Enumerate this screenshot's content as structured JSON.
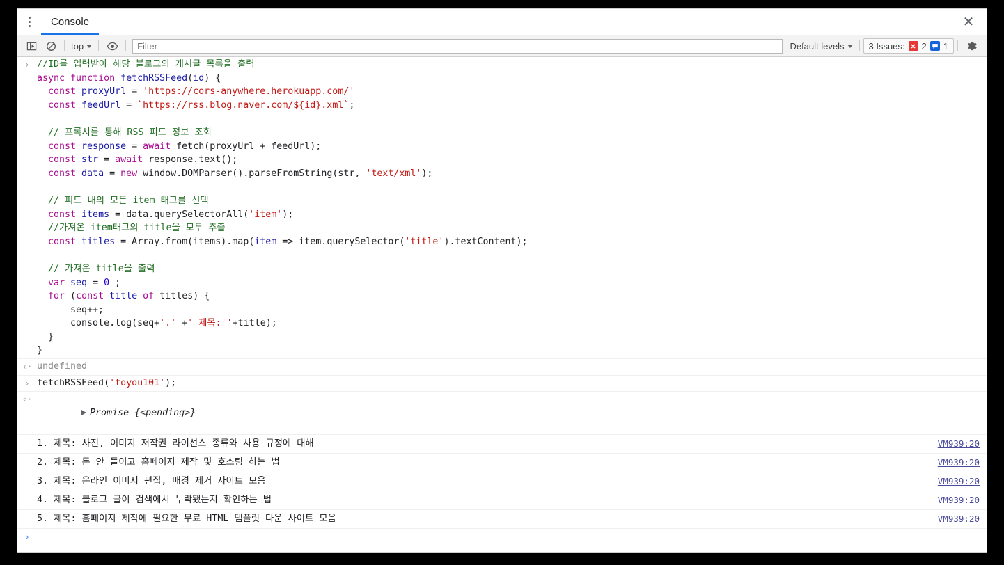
{
  "window": {
    "close_label": "✕"
  },
  "tabstrip": {
    "menu_icon": "more-vertical-icon",
    "tabs": [
      {
        "label": "Console",
        "active": true
      }
    ]
  },
  "toolbar": {
    "sidebar_toggle_icon": "show-console-sidebar-icon",
    "clear_console_icon": "clear-console-icon",
    "context_selector": {
      "label": "top"
    },
    "eye_icon": "live-expression-eye-icon",
    "filter": {
      "placeholder": "Filter",
      "value": ""
    },
    "levels_selector": {
      "label": "Default levels"
    },
    "issues": {
      "label": "3 Issues:",
      "error_count": "2",
      "message_count": "1",
      "error_color": "#e53935",
      "message_color": "#1565d8"
    },
    "settings_icon": "gear-icon"
  },
  "console": {
    "input_marker": "›",
    "output_marker": "‹·",
    "entries": [
      {
        "type": "input",
        "code_lines": [
          [
            {
              "t": "//ID를 입력받아 해당 블로그의 게시글 목록을 출력",
              "c": "cmt"
            }
          ],
          [
            {
              "t": "async ",
              "c": "kw"
            },
            {
              "t": "function ",
              "c": "kw"
            },
            {
              "t": "fetchRSSFeed",
              "c": "id"
            },
            {
              "t": "(",
              "c": "plain"
            },
            {
              "t": "id",
              "c": "id"
            },
            {
              "t": ") {",
              "c": "plain"
            }
          ],
          [
            {
              "t": "  const ",
              "c": "kw"
            },
            {
              "t": "proxyUrl",
              "c": "id"
            },
            {
              "t": " = ",
              "c": "plain"
            },
            {
              "t": "'https://cors-anywhere.herokuapp.com/'",
              "c": "str"
            }
          ],
          [
            {
              "t": "  const ",
              "c": "kw"
            },
            {
              "t": "feedUrl",
              "c": "id"
            },
            {
              "t": " = ",
              "c": "plain"
            },
            {
              "t": "`https://rss.blog.naver.com/${id}.xml`",
              "c": "str"
            },
            {
              "t": ";",
              "c": "plain"
            }
          ],
          [
            {
              "t": "",
              "c": "plain"
            }
          ],
          [
            {
              "t": "  // 프록시를 통해 RSS 피드 정보 조회",
              "c": "cmt"
            }
          ],
          [
            {
              "t": "  const ",
              "c": "kw"
            },
            {
              "t": "response",
              "c": "id"
            },
            {
              "t": " = ",
              "c": "plain"
            },
            {
              "t": "await ",
              "c": "kw"
            },
            {
              "t": "fetch(proxyUrl + feedUrl);",
              "c": "plain"
            }
          ],
          [
            {
              "t": "  const ",
              "c": "kw"
            },
            {
              "t": "str",
              "c": "id"
            },
            {
              "t": " = ",
              "c": "plain"
            },
            {
              "t": "await ",
              "c": "kw"
            },
            {
              "t": "response.text();",
              "c": "plain"
            }
          ],
          [
            {
              "t": "  const ",
              "c": "kw"
            },
            {
              "t": "data",
              "c": "id"
            },
            {
              "t": " = ",
              "c": "plain"
            },
            {
              "t": "new ",
              "c": "kw"
            },
            {
              "t": "window.DOMParser().parseFromString(str, ",
              "c": "plain"
            },
            {
              "t": "'text/xml'",
              "c": "str"
            },
            {
              "t": ");",
              "c": "plain"
            }
          ],
          [
            {
              "t": "",
              "c": "plain"
            }
          ],
          [
            {
              "t": "  // 피드 내의 모든 item 태그를 선택",
              "c": "cmt"
            }
          ],
          [
            {
              "t": "  const ",
              "c": "kw"
            },
            {
              "t": "items",
              "c": "id"
            },
            {
              "t": " = data.querySelectorAll(",
              "c": "plain"
            },
            {
              "t": "'item'",
              "c": "str"
            },
            {
              "t": ");",
              "c": "plain"
            }
          ],
          [
            {
              "t": "  //가져온 item태그의 title을 모두 추출",
              "c": "cmt"
            }
          ],
          [
            {
              "t": "  const ",
              "c": "kw"
            },
            {
              "t": "titles",
              "c": "id"
            },
            {
              "t": " = Array.from(items).map(",
              "c": "plain"
            },
            {
              "t": "item",
              "c": "id"
            },
            {
              "t": " => item.querySelector(",
              "c": "plain"
            },
            {
              "t": "'title'",
              "c": "str"
            },
            {
              "t": ").textContent);",
              "c": "plain"
            }
          ],
          [
            {
              "t": "",
              "c": "plain"
            }
          ],
          [
            {
              "t": "  // 가져온 title을 출력",
              "c": "cmt"
            }
          ],
          [
            {
              "t": "  var ",
              "c": "kw"
            },
            {
              "t": "seq",
              "c": "id"
            },
            {
              "t": " = ",
              "c": "plain"
            },
            {
              "t": "0",
              "c": "num"
            },
            {
              "t": " ;",
              "c": "plain"
            }
          ],
          [
            {
              "t": "  for ",
              "c": "kw"
            },
            {
              "t": "(",
              "c": "plain"
            },
            {
              "t": "const ",
              "c": "kw"
            },
            {
              "t": "title",
              "c": "id"
            },
            {
              "t": " of ",
              "c": "kw"
            },
            {
              "t": "titles) {",
              "c": "plain"
            }
          ],
          [
            {
              "t": "      seq++;",
              "c": "plain"
            }
          ],
          [
            {
              "t": "      console.log(seq+",
              "c": "plain"
            },
            {
              "t": "'.'",
              "c": "str"
            },
            {
              "t": " +",
              "c": "plain"
            },
            {
              "t": "' 제목: '",
              "c": "str"
            },
            {
              "t": "+title);",
              "c": "plain"
            }
          ],
          [
            {
              "t": "  }",
              "c": "plain"
            }
          ],
          [
            {
              "t": "}",
              "c": "plain"
            }
          ]
        ]
      },
      {
        "type": "output",
        "text": "undefined",
        "style": "undef"
      },
      {
        "type": "input",
        "code_lines": [
          [
            {
              "t": "fetchRSSFeed(",
              "c": "plain"
            },
            {
              "t": "'toyou101'",
              "c": "str"
            },
            {
              "t": ");",
              "c": "plain"
            }
          ]
        ]
      },
      {
        "type": "output-promise",
        "expandable": true,
        "label": "Promise",
        "value": " {<pending>}"
      }
    ],
    "log_rows": [
      {
        "message": "1. 제목: 사진, 이미지 저작권 라이선스 종류와 사용 규정에 대해",
        "source": "VM939:20"
      },
      {
        "message": "2. 제목: 돈 안 들이고 홈페이지 제작 및 호스팅 하는 법",
        "source": "VM939:20"
      },
      {
        "message": "3. 제목: 온라인 이미지 편집, 배경 제거 사이트 모음",
        "source": "VM939:20"
      },
      {
        "message": "4. 제목: 블로그 글이 검색에서 누락됐는지 확인하는 법",
        "source": "VM939:20"
      },
      {
        "message": "5. 제목: 홈페이지 제작에 필요한 무료 HTML 템플릿 다운 사이트 모음",
        "source": "VM939:20"
      }
    ],
    "prompt": {
      "marker": "›",
      "value": ""
    }
  }
}
